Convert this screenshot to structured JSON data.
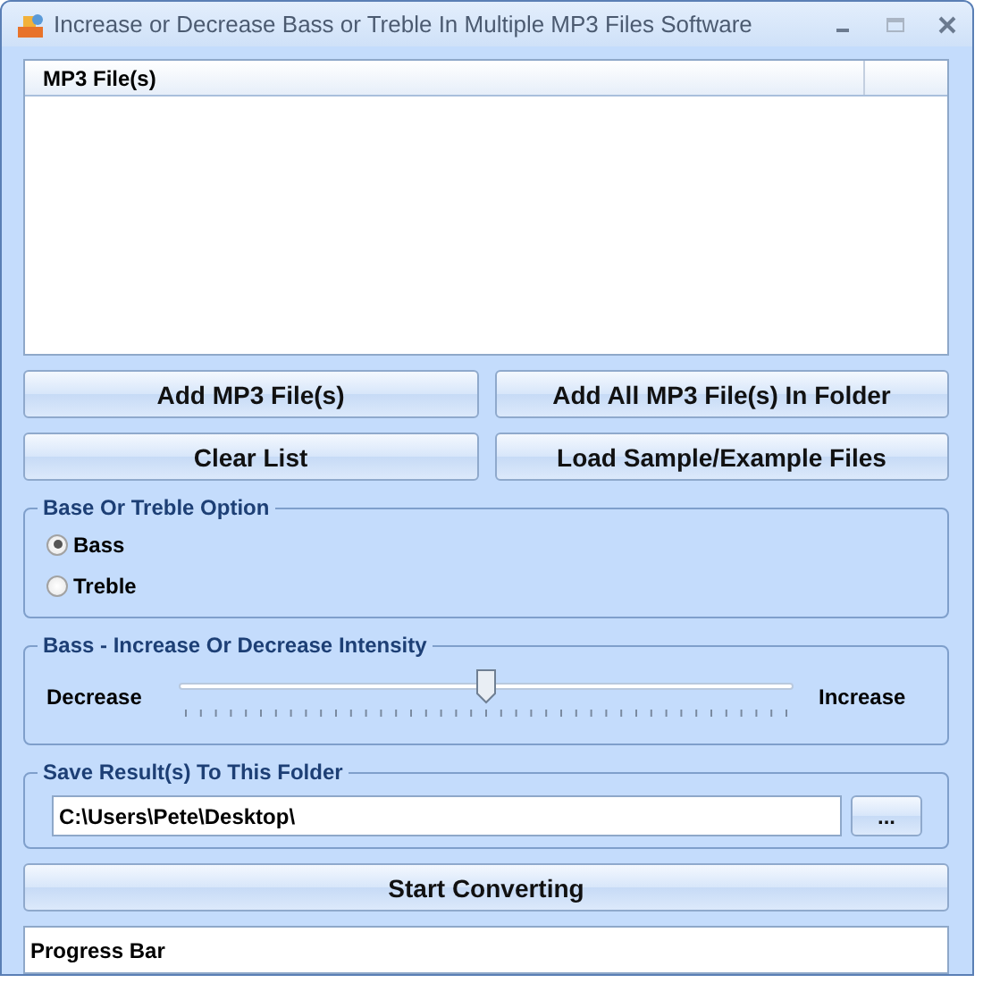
{
  "window": {
    "title": "Increase or Decrease Bass or Treble In Multiple MP3 Files Software"
  },
  "file_list": {
    "columns": [
      "MP3 File(s)"
    ]
  },
  "buttons_row_1": [
    "Add MP3 File(s)",
    "Add All MP3 File(s) In Folder"
  ],
  "buttons_row_2": [
    "Clear List",
    "Load Sample/Example Files"
  ],
  "option_group": {
    "title": "Base Or Treble Option",
    "options": [
      {
        "label": "Bass",
        "selected": true
      },
      {
        "label": "Treble",
        "selected": false
      }
    ]
  },
  "intensity_group": {
    "title": "Bass - Increase Or Decrease Intensity",
    "min_label": "Decrease",
    "max_label": "Increase",
    "level": 0.5
  },
  "folder_group": {
    "title": "Save Result(s) To This Folder",
    "value": "C:\\Users\\Pete\\Desktop\\",
    "browse": "..."
  },
  "start_button": "Start Converting",
  "progress": {
    "label": "Progress Bar"
  }
}
